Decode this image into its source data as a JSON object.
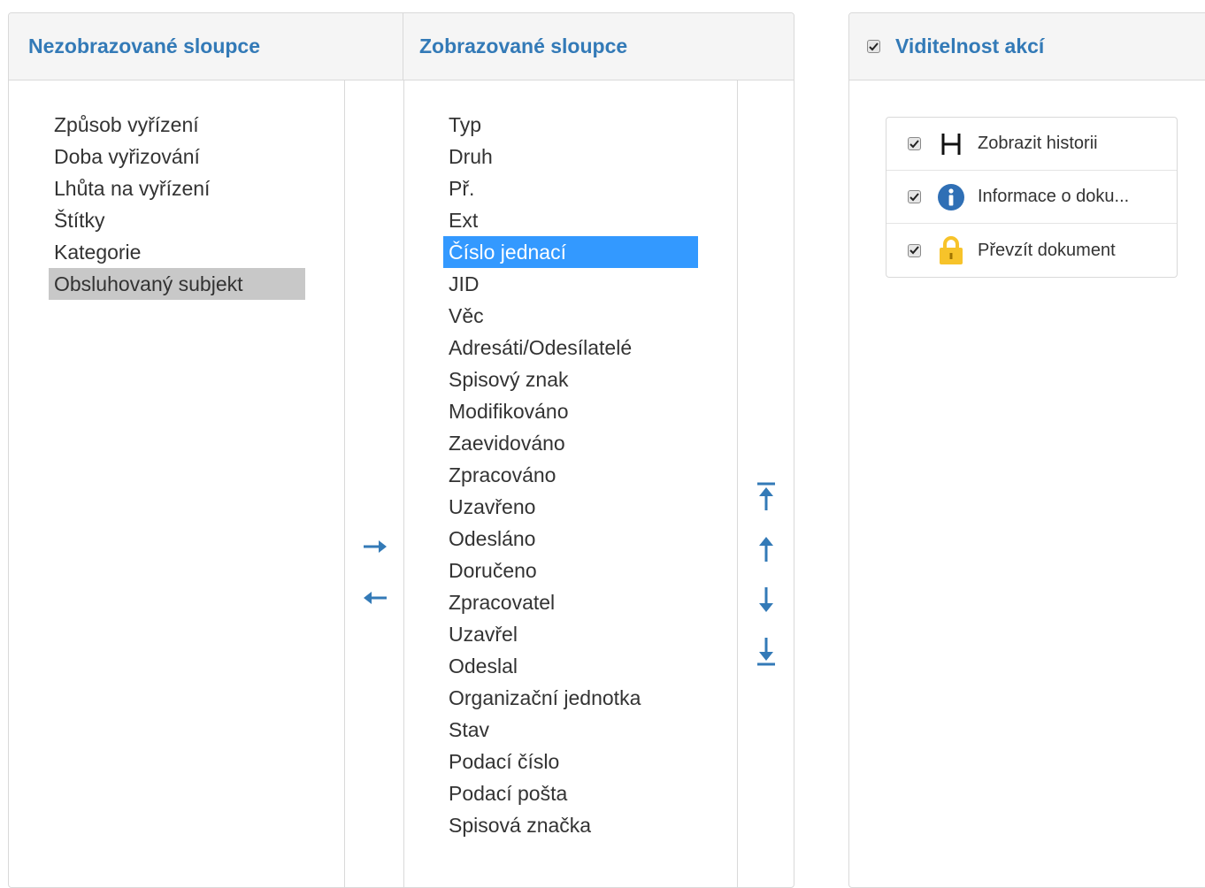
{
  "columns_panel": {
    "hidden_header": "Nezobrazované sloupce",
    "shown_header": "Zobrazované sloupce",
    "hidden_columns": [
      "Způsob vyřízení",
      "Doba vyřizování",
      "Lhůta na vyřízení",
      "Štítky",
      "Kategorie",
      "Obsluhovaný subjekt"
    ],
    "hidden_selected": "Obsluhovaný subjekt",
    "shown_columns": [
      "Typ",
      "Druh",
      "Př.",
      "Ext",
      "Číslo jednací",
      "JID",
      "Věc",
      "Adresáti/Odesílatelé",
      "Spisový znak",
      "Modifikováno",
      "Zaevidováno",
      "Zpracováno",
      "Uzavřeno",
      "Odesláno",
      "Doručeno",
      "Zpracovatel",
      "Uzavřel",
      "Odeslal",
      "Organizační jednotka",
      "Stav",
      "Podací číslo",
      "Podací pošta",
      "Spisová značka"
    ],
    "shown_selected": "Číslo jednací",
    "transfer_buttons": [
      "arrow-right-icon",
      "arrow-left-icon"
    ],
    "order_buttons": [
      "move-to-top-icon",
      "move-up-icon",
      "move-down-icon",
      "move-to-bottom-icon"
    ]
  },
  "actions_panel": {
    "header": "Viditelnost akcí",
    "header_checked": true,
    "actions": [
      {
        "icon": "history-h-icon",
        "label": "Zobrazit historii",
        "checked": true
      },
      {
        "icon": "info-circle-icon",
        "label": "Informace o doku...",
        "checked": true
      },
      {
        "icon": "padlock-icon",
        "label": "Převzít dokument",
        "checked": true
      }
    ]
  },
  "colors": {
    "accent": "#337ab7",
    "selection_blue": "#3399ff",
    "selection_grey": "#c8c8c8",
    "lock_yellow": "#f7c32a",
    "header_bg": "#f5f5f5"
  }
}
